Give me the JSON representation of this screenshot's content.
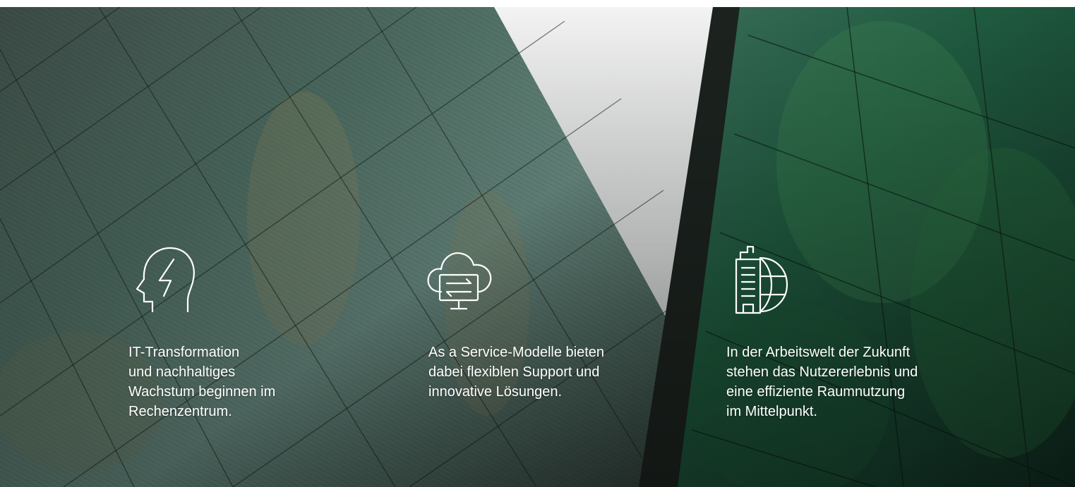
{
  "hero": {
    "features": [
      {
        "icon": "head-lightning-icon",
        "text": "IT-Transformation\nund nachhaltiges\nWachstum beginnen im\nRechenzentrum."
      },
      {
        "icon": "cloud-sync-monitor-icon",
        "text": "As a Service-Modelle bieten\ndabei flexiblen Support und\ninnovative Lösungen."
      },
      {
        "icon": "building-globe-icon",
        "text": "In der Arbeitswelt der Zukunft\nstehen das Nutzererlebnis und\neine effiziente Raumnutzung\nim Mittelpunkt."
      }
    ]
  }
}
